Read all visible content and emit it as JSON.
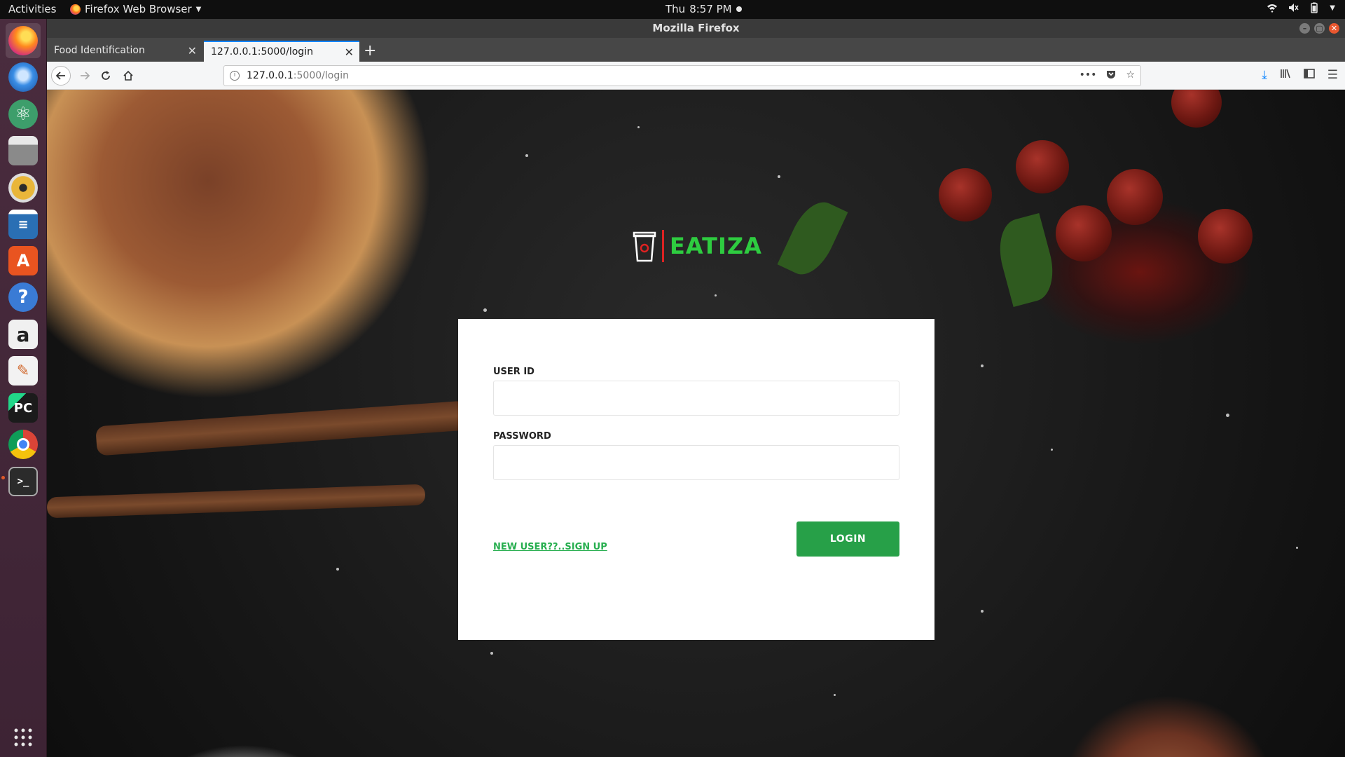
{
  "top_panel": {
    "activities": "Activities",
    "app_menu": "Firefox Web Browser",
    "day": "Thu",
    "time": "8:57 PM"
  },
  "launcher": {
    "items": [
      {
        "name": "firefox",
        "label": "Firefox Web Browser",
        "color": "#e66000"
      },
      {
        "name": "thunderbird",
        "label": "Thunderbird Mail",
        "color": "#1c6fb8"
      },
      {
        "name": "atom",
        "label": "Atom",
        "color": "#3d9e6b"
      },
      {
        "name": "files",
        "label": "Files",
        "color": "#8a8a8a"
      },
      {
        "name": "rhythmbox",
        "label": "Rhythmbox",
        "color": "#e9b63a"
      },
      {
        "name": "writer",
        "label": "LibreOffice Writer",
        "color": "#2a6fb4"
      },
      {
        "name": "software",
        "label": "Ubuntu Software",
        "color": "#e95420"
      },
      {
        "name": "help",
        "label": "Help",
        "color": "#3a7bd5"
      },
      {
        "name": "amazon",
        "label": "Amazon",
        "color": "#f0f0f0"
      },
      {
        "name": "text-editor",
        "label": "Text Editor",
        "color": "#f2f2f2"
      },
      {
        "name": "pycharm",
        "label": "PyCharm",
        "color": "#1b1b1b"
      },
      {
        "name": "chrome",
        "label": "Google Chrome",
        "color": "#db4437"
      },
      {
        "name": "terminal",
        "label": "Terminal",
        "color": "#2b2b2b"
      }
    ],
    "apps_grid": "Show Applications"
  },
  "window": {
    "title": "Mozilla Firefox"
  },
  "tabs": [
    {
      "label": "Food Identification",
      "selected": false
    },
    {
      "label": "127.0.0.1:5000/login",
      "selected": true
    }
  ],
  "urlbar": {
    "host": "127.0.0.1",
    "path": ":5000/login"
  },
  "page": {
    "brand": "EATIZA",
    "user_id_label": "USER ID",
    "user_id_value": "",
    "password_label": "PASSWORD",
    "password_value": "",
    "signup_link": "NEW USER??..SIGN UP",
    "login_button": "LOGIN",
    "accent_color": "#27a048"
  }
}
